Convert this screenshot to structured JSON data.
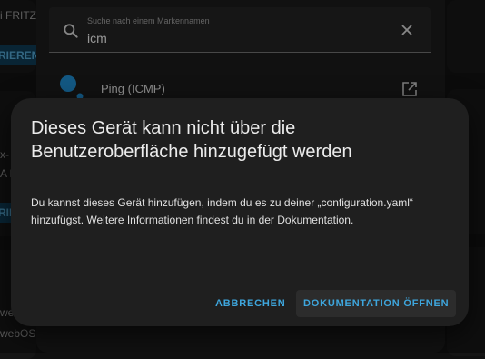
{
  "background": {
    "card1_text": "i FRITZ",
    "card1_button": "RIEREN",
    "card2_text_a": "x-",
    "card2_text_b": "A D",
    "card2_button": "RIEREN",
    "card3_text_a": "we",
    "card3_text_b": "webOS"
  },
  "search": {
    "label": "Suche nach einem Markennamen",
    "value": "icm",
    "result_label": "Ping (ICMP)"
  },
  "dialog": {
    "title": "Dieses Gerät kann nicht über die Benutzeroberfläche hinzugefügt werden",
    "body": "Du kannst dieses Gerät hinzufügen, indem du es zu deiner „configuration.yaml“ hinzufügst. Weitere Informationen findest du in der Dokumentation.",
    "cancel_label": "ABBRECHEN",
    "docs_label": "DOKUMENTATION ÖFFNEN"
  },
  "colors": {
    "accent": "#3ea6dd",
    "ping_icon": "#1e88c9"
  },
  "icons": [
    "search-icon",
    "close-icon",
    "ping-icon",
    "open-in-new-icon"
  ]
}
